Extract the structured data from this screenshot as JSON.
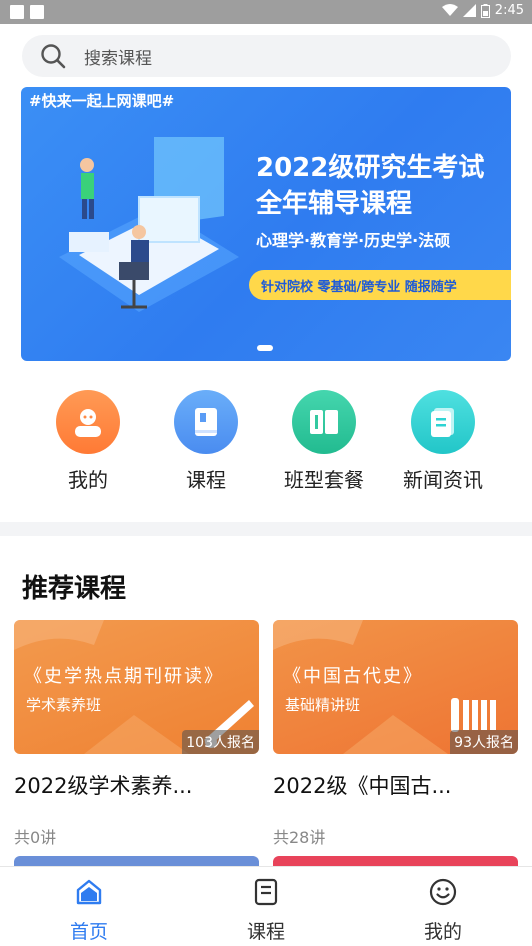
{
  "status_bar": {
    "time": "2:45",
    "icons": [
      "notification-square-icon",
      "notification-square-icon",
      "wifi-icon",
      "signal-icon",
      "battery-icon"
    ]
  },
  "search": {
    "placeholder": "搜索课程"
  },
  "banner": {
    "tag": "#快来一起上网课吧#",
    "title_line1": "2022级研究生考试",
    "title_line2": "全年辅导课程",
    "subjects": "心理学·教育学·历史学·法硕",
    "pill": "针对院校  零基础/跨专业  随报随学",
    "page_indicator": {
      "current": 1
    }
  },
  "quick_menu": [
    {
      "label": "我的",
      "icon": "user-icon",
      "color": "#ff8a45"
    },
    {
      "label": "课程",
      "icon": "book-icon",
      "color": "#5a9cf5"
    },
    {
      "label": "班型套餐",
      "icon": "package-icon",
      "color": "#33c9a0"
    },
    {
      "label": "新闻资讯",
      "icon": "news-icon",
      "color": "#2ed3d3"
    }
  ],
  "recommended": {
    "title": "推荐课程",
    "courses": [
      {
        "cover_title": "《史学热点期刊研读》",
        "cover_subtitle": "学术素养班",
        "enrolled": "103人报名",
        "title": "2022级学术素养...",
        "lessons": "共0讲",
        "color": "#f08a3c"
      },
      {
        "cover_title": "《中国古代史》",
        "cover_subtitle": "基础精讲班",
        "enrolled": "93人报名",
        "title": "2022级《中国古...",
        "lessons": "共28讲",
        "color": "#f07a3a"
      }
    ]
  },
  "tab_bar": {
    "items": [
      {
        "label": "首页",
        "icon": "home-icon",
        "active": true
      },
      {
        "label": "课程",
        "icon": "course-list-icon",
        "active": false
      },
      {
        "label": "我的",
        "icon": "smiley-icon",
        "active": false
      }
    ],
    "active_color": "#2f7cf0",
    "inactive_color": "#333333"
  }
}
